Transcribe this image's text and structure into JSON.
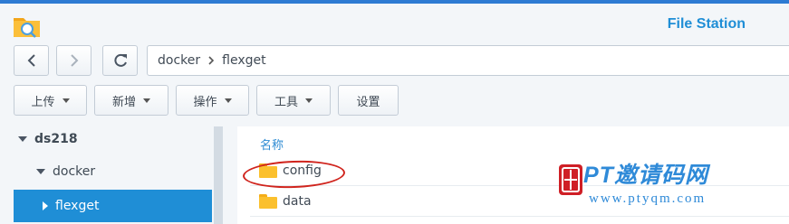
{
  "app": {
    "title": "File Station"
  },
  "nav": {
    "back": "back",
    "forward": "forward",
    "refresh": "refresh"
  },
  "breadcrumb": {
    "items": [
      "docker",
      "flexget"
    ]
  },
  "toolbar": {
    "upload": "上传",
    "create": "新增",
    "action": "操作",
    "tools": "工具",
    "settings": "设置"
  },
  "sidebar": {
    "root": "ds218",
    "folder": "docker",
    "selected": "flexget"
  },
  "list": {
    "column_name": "名称",
    "rows": [
      {
        "name": "config"
      },
      {
        "name": "data"
      }
    ]
  },
  "watermark": {
    "title": "PT邀请码网",
    "url": "www.ptyqm.com",
    "seal_char": "邀"
  },
  "colors": {
    "accent": "#1f8ed6",
    "folder": "#fbc02d",
    "annotation": "#d0241d"
  }
}
